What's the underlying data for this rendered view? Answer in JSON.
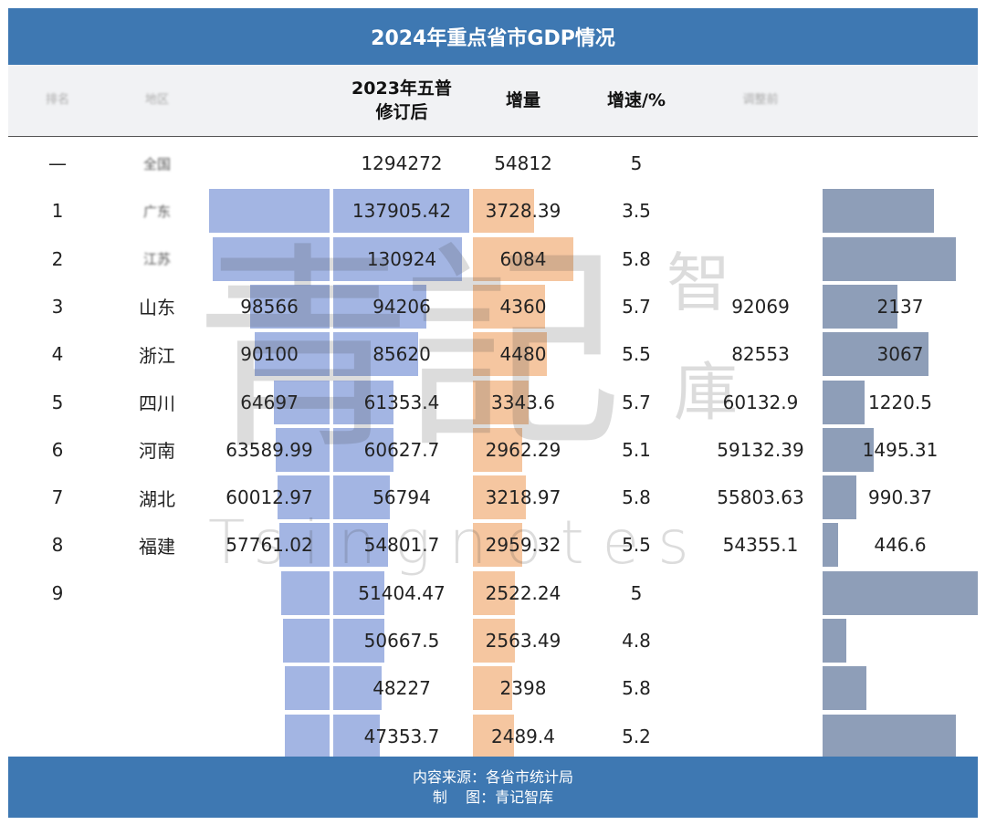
{
  "title": "2024年重点省市GDP情况",
  "header": {
    "col_rank": "排名",
    "col_region": "地区",
    "col_revised_line1": "2023年五普",
    "col_revised_line2": "修订后",
    "col_increment": "增量",
    "col_growth": "增速/%",
    "col_blur": "调整前"
  },
  "colors": {
    "title_bg": "#3e78b2",
    "bar_2024": "#a3b5e3",
    "bar_increment": "#f5c6a0",
    "bar_change": "#8e9eb8"
  },
  "rows": [
    {
      "rank": "—",
      "region": "全国",
      "gdp2024": "",
      "gdp2023_revised": "1294272",
      "increment": "54812",
      "growth": "5",
      "gdp2023_before": "",
      "change": "",
      "bar2024": 0,
      "barrev": 0,
      "barinc": 0,
      "barchg": 0,
      "blur_region": true,
      "blur_2024": false,
      "blur_before": true
    },
    {
      "rank": "1",
      "region": "广东",
      "gdp2024": "",
      "gdp2023_revised": "137905.42",
      "increment": "3728.39",
      "growth": "3.5",
      "gdp2023_before": "",
      "change": "",
      "bar2024": 1.0,
      "barrev": 0.99,
      "barinc": 0.61,
      "barchg": 0.72,
      "blur_region": true,
      "blur_2024": true,
      "blur_before": true
    },
    {
      "rank": "2",
      "region": "江苏",
      "gdp2024": "",
      "gdp2023_revised": "130924",
      "increment": "6084",
      "growth": "5.8",
      "gdp2023_before": "",
      "change": "",
      "bar2024": 0.97,
      "barrev": 0.94,
      "barinc": 1.0,
      "barchg": 0.86,
      "blur_region": true,
      "blur_2024": true,
      "blur_before": true
    },
    {
      "rank": "3",
      "region": "山东",
      "gdp2024": "98566",
      "gdp2023_revised": "94206",
      "increment": "4360",
      "growth": "5.7",
      "gdp2023_before": "92069",
      "change": "2137",
      "bar2024": 0.66,
      "barrev": 0.68,
      "barinc": 0.72,
      "barchg": 0.48,
      "blur_region": false,
      "blur_2024": false,
      "blur_before": false
    },
    {
      "rank": "4",
      "region": "浙江",
      "gdp2024": "90100",
      "gdp2023_revised": "85620",
      "increment": "4480",
      "growth": "5.5",
      "gdp2023_before": "82553",
      "change": "3067",
      "bar2024": 0.62,
      "barrev": 0.62,
      "barinc": 0.74,
      "barchg": 0.68,
      "blur_region": false,
      "blur_2024": false,
      "blur_before": false
    },
    {
      "rank": "5",
      "region": "四川",
      "gdp2024": "64697",
      "gdp2023_revised": "61353.4",
      "increment": "3343.6",
      "growth": "5.7",
      "gdp2023_before": "60132.9",
      "change": "1220.5",
      "bar2024": 0.46,
      "barrev": 0.44,
      "barinc": 0.55,
      "barchg": 0.27,
      "blur_region": false,
      "blur_2024": false,
      "blur_before": false
    },
    {
      "rank": "6",
      "region": "河南",
      "gdp2024": "63589.99",
      "gdp2023_revised": "60627.7",
      "increment": "2962.29",
      "growth": "5.1",
      "gdp2023_before": "59132.39",
      "change": "1495.31",
      "bar2024": 0.45,
      "barrev": 0.44,
      "barinc": 0.49,
      "barchg": 0.33,
      "blur_region": false,
      "blur_2024": false,
      "blur_before": false
    },
    {
      "rank": "7",
      "region": "湖北",
      "gdp2024": "60012.97",
      "gdp2023_revised": "56794",
      "increment": "3218.97",
      "growth": "5.8",
      "gdp2023_before": "55803.63",
      "change": "990.37",
      "bar2024": 0.43,
      "barrev": 0.41,
      "barinc": 0.53,
      "barchg": 0.22,
      "blur_region": false,
      "blur_2024": false,
      "blur_before": false
    },
    {
      "rank": "8",
      "region": "福建",
      "gdp2024": "57761.02",
      "gdp2023_revised": "54801.7",
      "increment": "2959.32",
      "growth": "5.5",
      "gdp2023_before": "54355.1",
      "change": "446.6",
      "bar2024": 0.42,
      "barrev": 0.4,
      "barinc": 0.49,
      "barchg": 0.1,
      "blur_region": false,
      "blur_2024": false,
      "blur_before": false
    },
    {
      "rank": "9",
      "region": "",
      "gdp2024": "",
      "gdp2023_revised": "51404.47",
      "increment": "2522.24",
      "growth": "5",
      "gdp2023_before": "",
      "change": "",
      "bar2024": 0.4,
      "barrev": 0.37,
      "barinc": 0.42,
      "barchg": 1.0,
      "blur_region": true,
      "blur_2024": true,
      "blur_before": true
    },
    {
      "rank": "",
      "region": "",
      "gdp2024": "",
      "gdp2023_revised": "50667.5",
      "increment": "2563.49",
      "growth": "4.8",
      "gdp2023_before": "",
      "change": "",
      "bar2024": 0.39,
      "barrev": 0.37,
      "barinc": 0.42,
      "barchg": 0.15,
      "blur_region": true,
      "blur_2024": true,
      "blur_before": true
    },
    {
      "rank": "",
      "region": "",
      "gdp2024": "",
      "gdp2023_revised": "48227",
      "increment": "2398",
      "growth": "5.8",
      "gdp2023_before": "",
      "change": "",
      "bar2024": 0.37,
      "barrev": 0.35,
      "barinc": 0.39,
      "barchg": 0.28,
      "blur_region": true,
      "blur_2024": true,
      "blur_before": true
    },
    {
      "rank": "",
      "region": "",
      "gdp2024": "",
      "gdp2023_revised": "47353.7",
      "increment": "2489.4",
      "growth": "5.2",
      "gdp2023_before": "",
      "change": "",
      "bar2024": 0.37,
      "barrev": 0.34,
      "barinc": 0.41,
      "barchg": 0.86,
      "blur_region": true,
      "blur_2024": true,
      "blur_before": true
    }
  ],
  "watermark": {
    "main": "青記",
    "side1": "智",
    "side2": "庫",
    "latin": "Tsingnotes"
  },
  "footer": {
    "source": "内容来源：各省市统计局",
    "maker": "制    图：青记智库"
  }
}
